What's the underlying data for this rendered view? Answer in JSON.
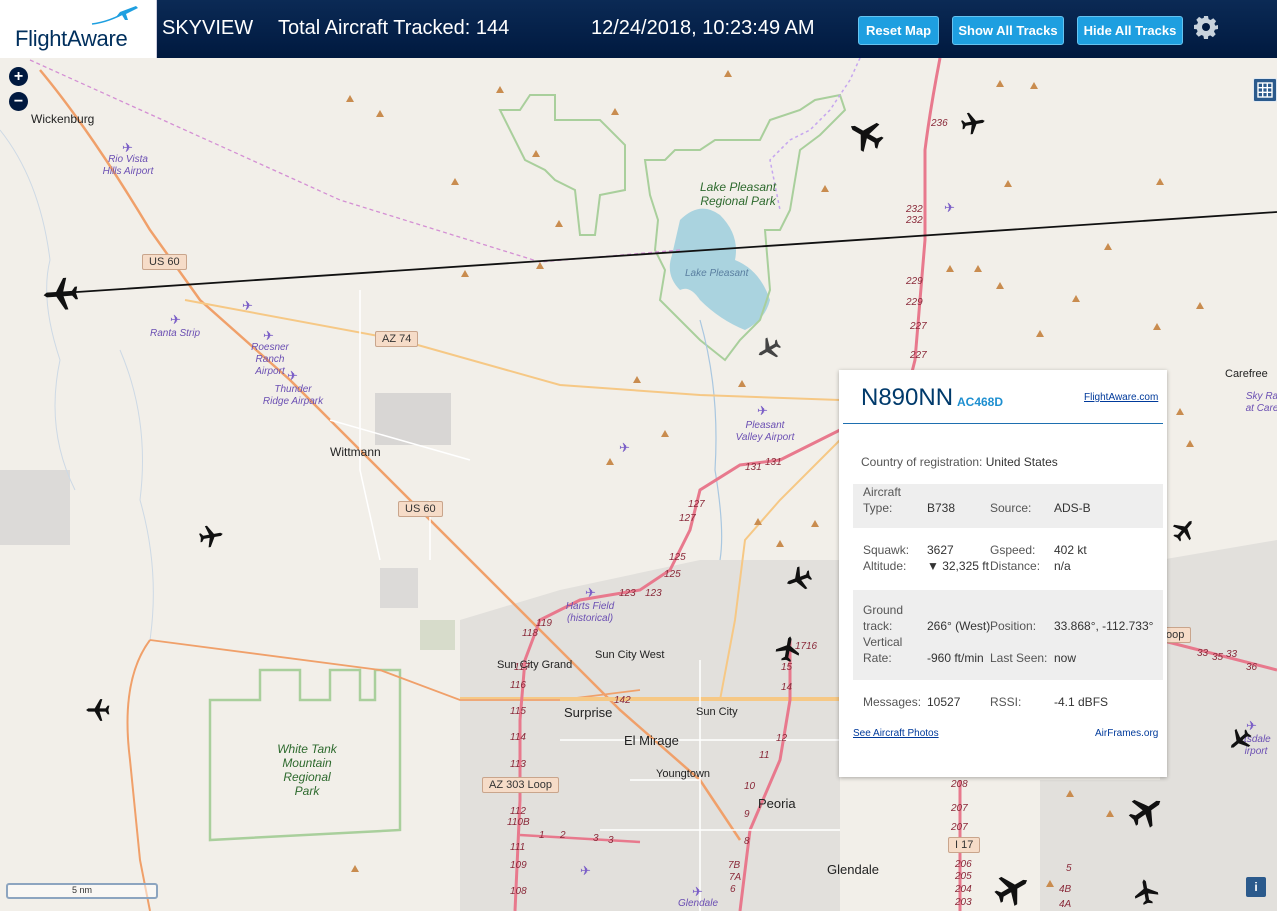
{
  "header": {
    "logo": "FlightAware",
    "app_title": "SKYVIEW",
    "tracked_label": "Total Aircraft Tracked: 144",
    "timestamp": "12/24/2018, 10:23:49 AM",
    "buttons": {
      "reset": "Reset Map",
      "show_tracks": "Show All Tracks",
      "hide_tracks": "Hide All Tracks"
    },
    "settings_icon": "gear-icon"
  },
  "map": {
    "zoom_in": "+",
    "zoom_out": "−",
    "scale": "5 nm",
    "info": "i",
    "places": [
      "Wickenburg",
      "Wittmann",
      "Sun City Grand",
      "Sun City West",
      "Surprise",
      "Sun City",
      "El Mirage",
      "Youngtown",
      "Peoria",
      "Glendale",
      "Carefree"
    ],
    "airports": [
      "Rio Vista Hills Airport",
      "Ranta Strip",
      "Roesner Ranch Airport",
      "Thunder Ridge Airpark",
      "Pleasant Valley Airport",
      "Harts Field (historical)",
      "Sky Ra at Care",
      "ttsdale irport",
      "Glendale"
    ],
    "parks": [
      "Lake Pleasant Regional Park",
      "Lake Pleasant",
      "White Tank Mountain Regional Park"
    ],
    "shields": [
      "US 60",
      "AZ 74",
      "US 60",
      "AZ 303 Loop",
      "I 17",
      "oop"
    ],
    "highway_numbers": [
      "236",
      "232",
      "232",
      "229",
      "229",
      "227",
      "227",
      "131",
      "131",
      "127",
      "127",
      "125",
      "125",
      "123",
      "123",
      "119",
      "118",
      "117",
      "116",
      "115",
      "114",
      "113",
      "112",
      "110B",
      "111",
      "109",
      "108",
      "142",
      "17",
      "16",
      "15",
      "14",
      "12",
      "11",
      "10",
      "9",
      "8",
      "7B",
      "7A",
      "6",
      "1",
      "2",
      "3",
      "3",
      "208",
      "207",
      "207",
      "206",
      "205",
      "204",
      "203",
      "5",
      "4B",
      "4A",
      "33",
      "33",
      "35",
      "36"
    ]
  },
  "popup": {
    "ident": "N890NN",
    "hex": "AC468D",
    "link": "FlightAware.com",
    "country_label": "Country of registration:",
    "country": "United States",
    "aircraft_type_label": "Aircraft Type:",
    "aircraft_type": "B738",
    "source_label": "Source:",
    "source": "ADS-B",
    "squawk_label": "Squawk:",
    "squawk": "3627",
    "gspeed_label": "Gspeed:",
    "gspeed": "402 kt",
    "altitude_label": "Altitude:",
    "altitude": "▼ 32,325 ft",
    "distance_label": "Distance:",
    "distance": "n/a",
    "ground_track_label": "Ground track:",
    "ground_track": "266° (West)",
    "position_label": "Position:",
    "position": "33.868°, -112.733°",
    "vrate_label": "Vertical Rate:",
    "vrate": "-960 ft/min",
    "last_seen_label": "Last Seen:",
    "last_seen": "now",
    "messages_label": "Messages:",
    "messages": "10527",
    "rssi_label": "RSSI:",
    "rssi": "-4.1 dBFS",
    "photos_link": "See Aircraft Photos",
    "airframes_link": "AirFrames.org"
  }
}
